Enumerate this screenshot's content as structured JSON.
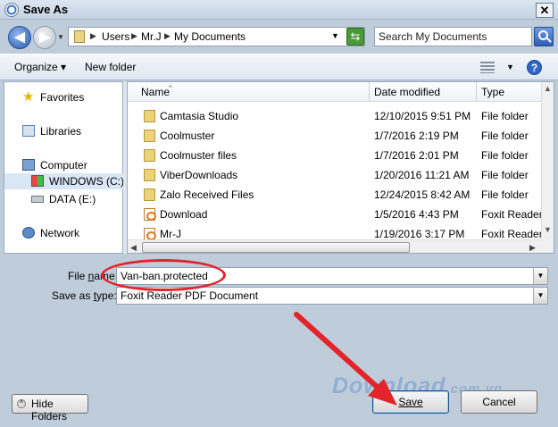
{
  "window": {
    "title": "Save As",
    "close_glyph": "✕"
  },
  "nav": {
    "back_glyph": "◀",
    "forward_glyph": "▶",
    "drop_glyph": "▼"
  },
  "breadcrumb": {
    "items": [
      "Users",
      "Mr.J",
      "My Documents"
    ],
    "sep_glyph": "▶",
    "drop_glyph": "▼"
  },
  "refresh_glyph": "⇆",
  "search": {
    "placeholder": "Search My Documents"
  },
  "toolbar": {
    "organize_label": "Organize ▾",
    "new_folder_label": "New folder",
    "views_drop": "▼",
    "help_glyph": "?"
  },
  "sidebar": {
    "items": [
      {
        "label": "Favorites",
        "icon": "star-icon"
      },
      {
        "label": "Libraries",
        "icon": "library-icon"
      },
      {
        "label": "Computer",
        "icon": "computer-icon"
      },
      {
        "label": "WINDOWS (C:)",
        "icon": "drive-icon",
        "selected": true
      },
      {
        "label": "DATA (E:)",
        "icon": "drive-icon"
      },
      {
        "label": "Network",
        "icon": "network-icon"
      }
    ]
  },
  "file_list": {
    "columns": {
      "name": "Name",
      "date": "Date modified",
      "type": "Type",
      "sort_glyph": "^"
    },
    "rows": [
      {
        "name": "Camtasia Studio",
        "date": "12/10/2015 9:51 PM",
        "type": "File folder",
        "icon": "folder-icon"
      },
      {
        "name": "Coolmuster",
        "date": "1/7/2016 2:19 PM",
        "type": "File folder",
        "icon": "folder-icon"
      },
      {
        "name": "Coolmuster files",
        "date": "1/7/2016 2:01 PM",
        "type": "File folder",
        "icon": "folder-icon"
      },
      {
        "name": "ViberDownloads",
        "date": "1/20/2016 11:21 AM",
        "type": "File folder",
        "icon": "folder-icon"
      },
      {
        "name": "Zalo Received Files",
        "date": "12/24/2015 8:42 AM",
        "type": "File folder",
        "icon": "folder-icon"
      },
      {
        "name": "Download",
        "date": "1/5/2016 4:43 PM",
        "type": "Foxit Reader",
        "icon": "pdf-icon"
      },
      {
        "name": "Mr-J",
        "date": "1/19/2016 3:17 PM",
        "type": "Foxit Reader",
        "icon": "pdf-icon"
      }
    ],
    "scroll_up": "▲",
    "scroll_down": "▼",
    "scroll_left": "◀",
    "scroll_right": "▶"
  },
  "form": {
    "file_name_label_a": "File ",
    "file_name_label_u": "n",
    "file_name_label_b": "ame:",
    "file_name_value": "Van-ban.protected",
    "save_type_label_a": "Save as ",
    "save_type_label_u": "t",
    "save_type_label_b": "ype:",
    "save_type_value": "Foxit Reader PDF Document",
    "dropdown_glyph": "▼"
  },
  "footer": {
    "hide_folders_label": "Hide Folders",
    "hide_folders_glyph": "^",
    "save_label": "Save",
    "cancel_label": "Cancel",
    "watermark_main": "Download",
    "watermark_suffix": ".com.vn"
  },
  "colors": {
    "accent_annotation": "#e3242b",
    "selection": "#d9e6f5",
    "chrome": "#bfcddb"
  }
}
